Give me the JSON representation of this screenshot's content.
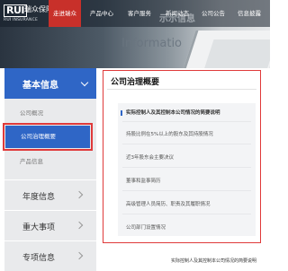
{
  "header": {
    "logo_mark": "RUI",
    "logo_cn": "瑞众保险",
    "logo_en": "RUI INSURANCE",
    "nav": [
      "走进瑞众",
      "产品中心",
      "客户服务",
      "新闻动态",
      "公司公告",
      "信息披露"
    ],
    "active_nav_index": 0,
    "banner_text": "Informatio",
    "banner_text_cn": "示示信息"
  },
  "sidebar": {
    "section_title": "基本信息",
    "sub_items": [
      "公司概况",
      "公司治理概要",
      "产品信息"
    ],
    "active_sub_index": 1,
    "groups": [
      "年度信息",
      "重大事项",
      "专项信息"
    ]
  },
  "panel": {
    "title": "公司治理概要",
    "heading": "实际控制人及其控制本公司情况的简要说明",
    "items": [
      "持股比例在5%以上的股东及其持股情况",
      "近3年股东会主要决议",
      "董事和监事简历",
      "高级管理人员简历、职责及其履职情况",
      "公司部门设置情况"
    ]
  },
  "footer": {
    "link": "实际控制人及其控制本公司情况的简要说明"
  },
  "colors": {
    "accent_blue": "#2f66c6",
    "highlight_red": "#e03a3a",
    "nav_active": "#c8302a"
  }
}
